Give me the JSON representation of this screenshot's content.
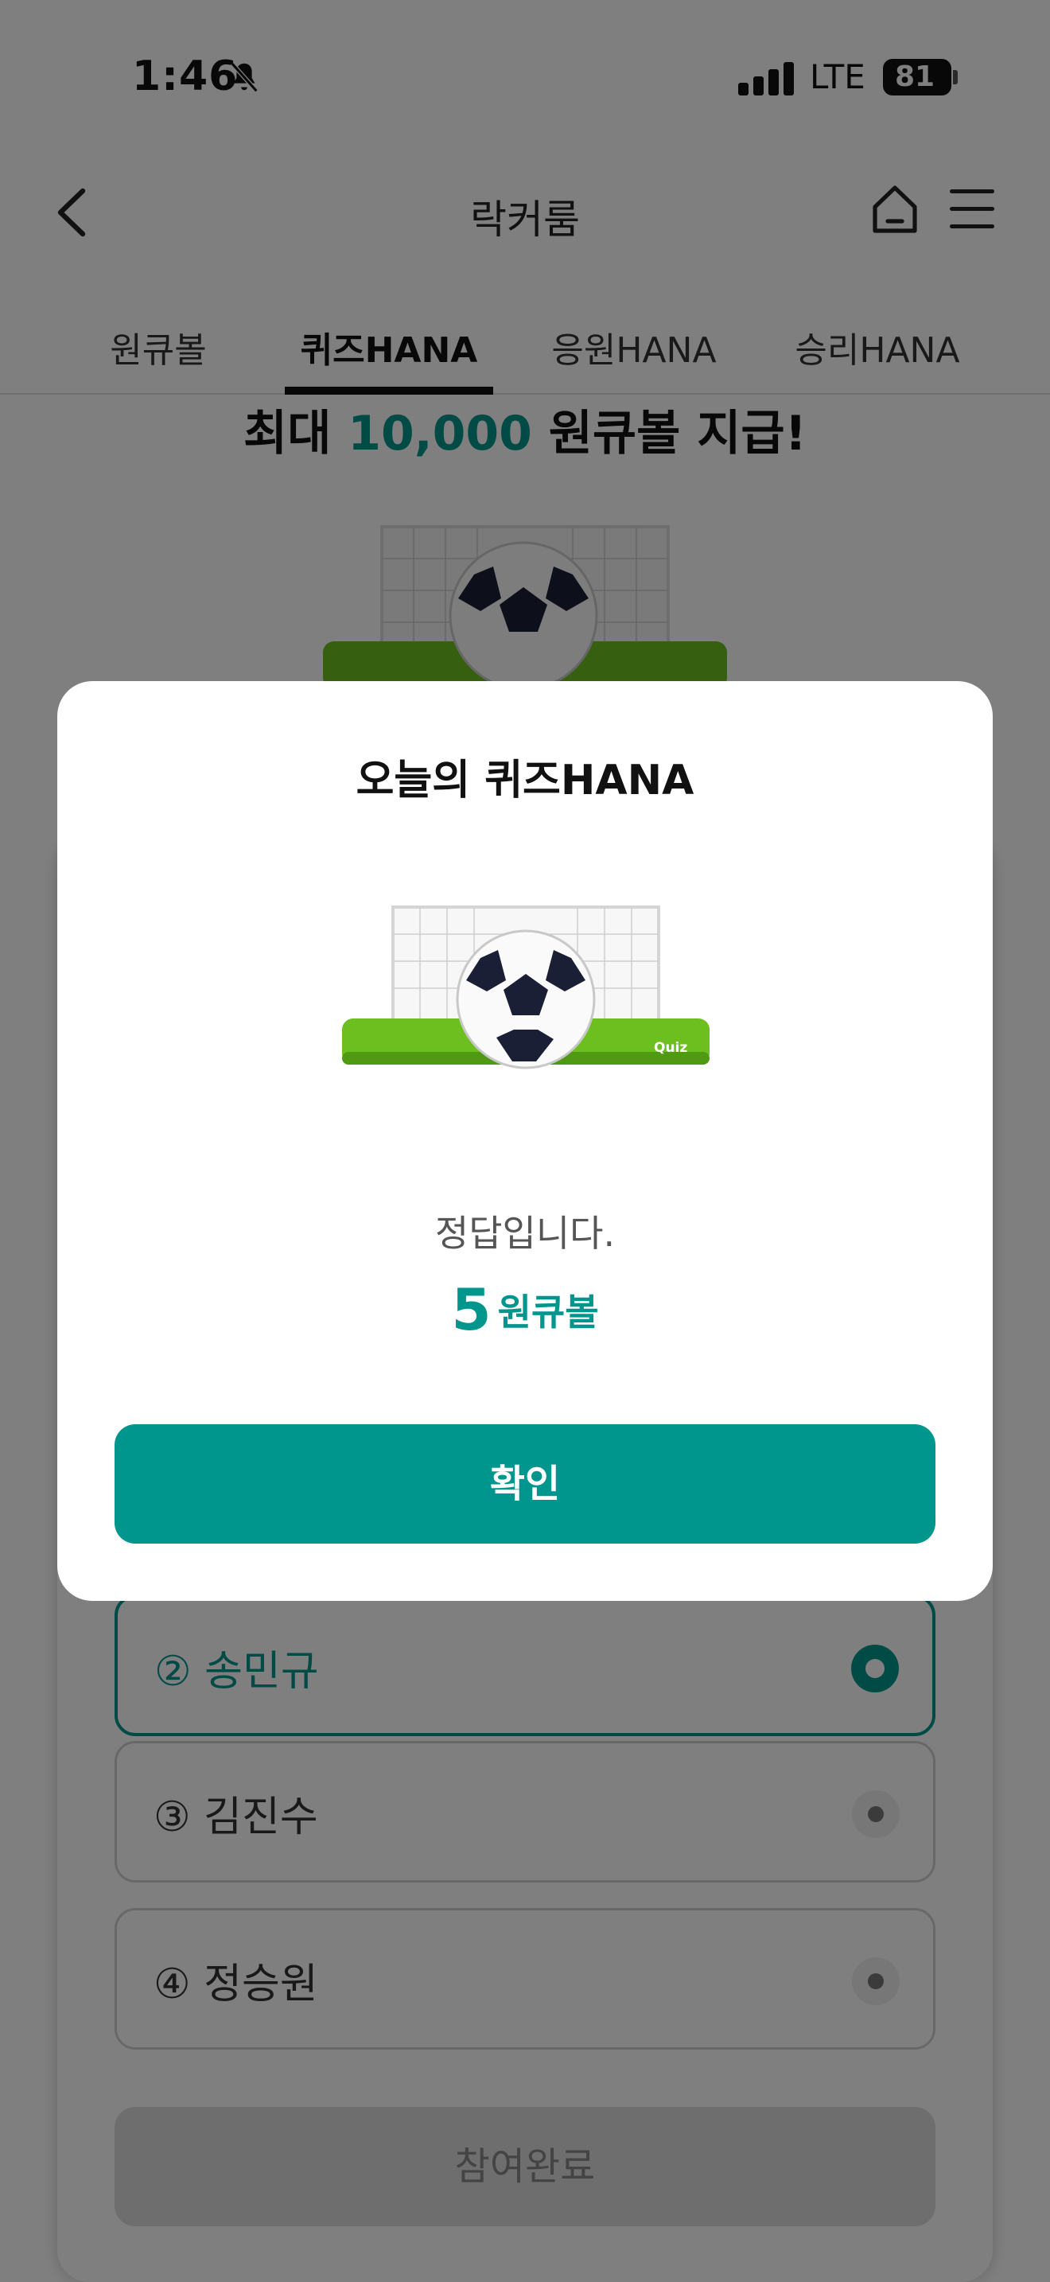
{
  "status_bar": {
    "time": "1:46",
    "network": "LTE",
    "battery": "81"
  },
  "header": {
    "title": "락커룸"
  },
  "tabs": [
    {
      "label": "원큐볼"
    },
    {
      "label": "퀴즈HANA"
    },
    {
      "label": "응원HANA"
    },
    {
      "label": "승리HANA"
    }
  ],
  "promo": {
    "prefix": "최대 ",
    "amount": "10,000",
    "suffix": " 원큐볼 지급!"
  },
  "quiz": {
    "options": [
      {
        "label": "② 송민규"
      },
      {
        "label": "③ 김진수"
      },
      {
        "label": "④ 정승원"
      }
    ],
    "selected_index": 0,
    "submit_label": "참여완료"
  },
  "modal": {
    "title": "오늘의 퀴즈HANA",
    "illustration_label": "Quiz",
    "message": "정답입니다.",
    "reward_amount": "5",
    "reward_unit": "원큐볼",
    "confirm_label": "확인"
  },
  "colors": {
    "accent": "#00968d",
    "field_green": "#6cbf1e"
  },
  "icons": [
    "back-arrow-icon",
    "home-icon",
    "menu-icon",
    "bell-off-icon",
    "signal-icon",
    "battery-icon",
    "soccer-ball-icon",
    "goal-net-icon"
  ]
}
